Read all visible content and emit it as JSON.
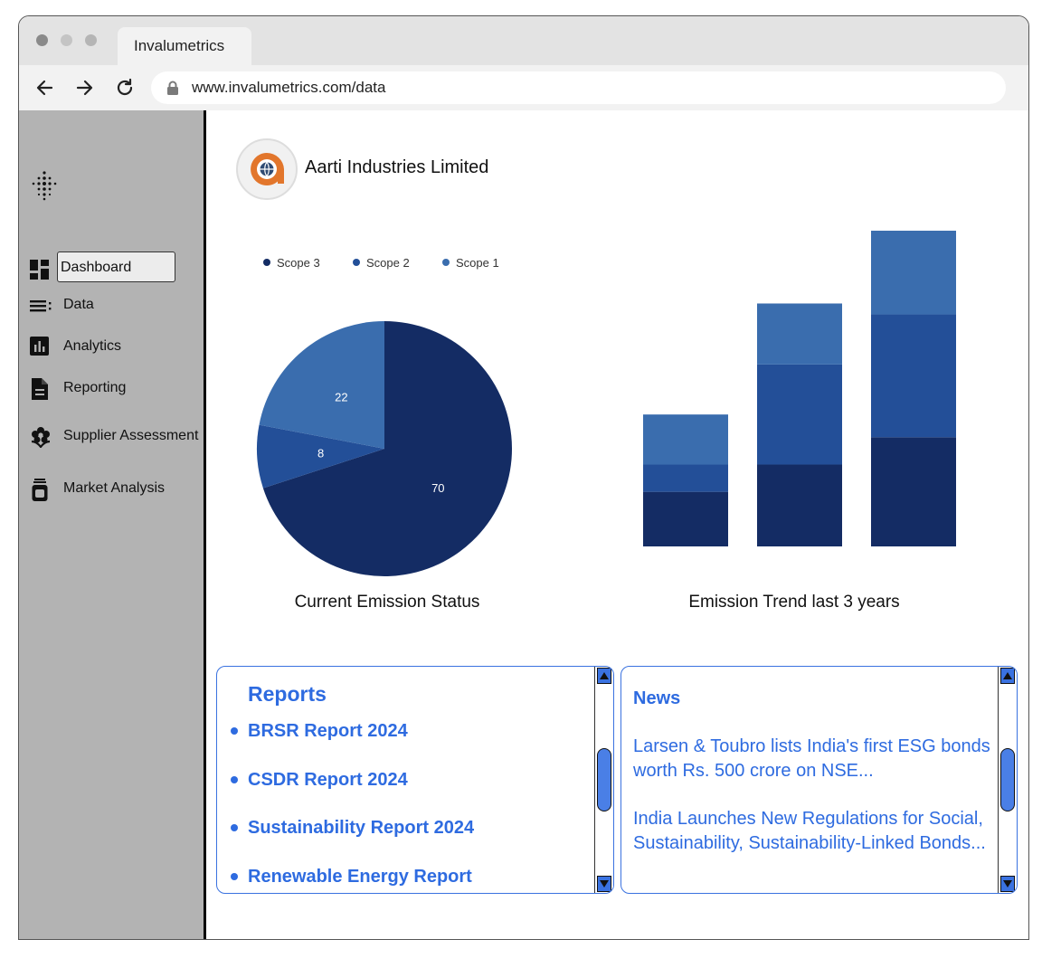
{
  "browser": {
    "tab_title": "Invalumetrics",
    "url": "www.invalumetrics.com/data",
    "traffic_light_colors": [
      "#8a8a8a",
      "#c4c4c4",
      "#b5b5b5"
    ]
  },
  "sidebar": {
    "items": [
      {
        "label": "Dashboard",
        "icon": "dashboard-icon",
        "active": true
      },
      {
        "label": "Data",
        "icon": "list-icon"
      },
      {
        "label": "Analytics",
        "icon": "bar-chart-icon"
      },
      {
        "label": "Reporting",
        "icon": "document-icon"
      },
      {
        "label": "Supplier Assessment",
        "icon": "flower-icon"
      },
      {
        "label": "Market Analysis",
        "icon": "jar-icon"
      }
    ]
  },
  "header": {
    "company_name": "Aarti Industries Limited"
  },
  "colors": {
    "scope3": "#142c64",
    "scope2": "#234f98",
    "scope1": "#3a6dae",
    "accent": "#2e6be0"
  },
  "pie_chart": {
    "title": "Current Emission Status",
    "legend": [
      "Scope 3",
      "Scope 2",
      "Scope 1"
    ]
  },
  "bar_chart": {
    "title": "Emission Trend last 3 years"
  },
  "chart_data": [
    {
      "type": "pie",
      "title": "Current Emission Status",
      "legend_position": "top",
      "slices": [
        {
          "label": "Scope 3",
          "value": 70
        },
        {
          "label": "Scope 2",
          "value": 8
        },
        {
          "label": "Scope 1",
          "value": 22
        }
      ]
    },
    {
      "type": "bar",
      "stacked": true,
      "title": "Emission Trend last 3 years",
      "categories": [
        "",
        "",
        ""
      ],
      "series": [
        {
          "name": "Scope 3",
          "values": [
            60,
            90,
            120
          ]
        },
        {
          "name": "Scope 2",
          "values": [
            30,
            110,
            135
          ]
        },
        {
          "name": "Scope 1",
          "values": [
            55,
            67,
            92
          ]
        }
      ],
      "ylim": [
        0,
        350
      ],
      "axes_visible": false
    }
  ],
  "reports": {
    "title": "Reports",
    "items": [
      "BRSR Report 2024",
      "CSDR Report 2024",
      "Sustainability Report 2024",
      "Renewable Energy Report"
    ]
  },
  "news": {
    "title": "News",
    "items": [
      "Larsen & Toubro lists India's first ESG bonds worth Rs. 500 crore on NSE...",
      "India Launches New Regulations for Social, Sustainability, Sustainability-Linked Bonds..."
    ]
  }
}
